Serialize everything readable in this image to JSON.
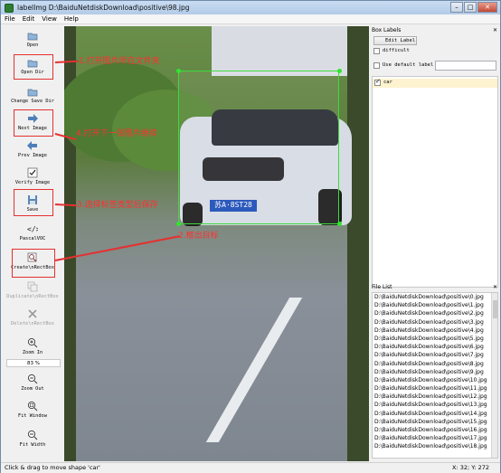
{
  "window": {
    "title": "labelImg D:\\BaiduNetdiskDownload\\positive\\98.jpg"
  },
  "menu": [
    "File",
    "Edit",
    "View",
    "Help"
  ],
  "toolbar": {
    "open": "Open",
    "open_dir": "Open Dir",
    "change_save_dir": "Change Save Dir",
    "next_image": "Next Image",
    "prev_image": "Prev Image",
    "verify_image": "Verify Image",
    "save": "Save",
    "format": "PascalVOC",
    "create_rect_box": "Create\\nRectBox",
    "duplicate_rect_box": "Duplicate\\nRectBox",
    "delete_rect_box": "Delete\\nRectBox",
    "zoom_in": "Zoom In",
    "zoom_value": "83 %",
    "zoom_out": "Zoom Out",
    "fit_window": "Fit Window",
    "fit_width": "Fit Width"
  },
  "annotations": {
    "step1": "1.打开图片所在文件夹",
    "step2": "2.框出目标",
    "step3": "3.选择标签类型后保存",
    "step4": "4.打开下一张图片继续"
  },
  "image": {
    "plate_text": "苏A·8ST28"
  },
  "box_labels": {
    "title": "Box Labels",
    "edit_label": "Edit Label",
    "difficult": "difficult",
    "use_default_label": "Use default label",
    "default_label_value": "",
    "labels": [
      {
        "name": "car",
        "checked": true
      }
    ]
  },
  "file_list": {
    "title": "File List",
    "items": [
      "D:\\BaiduNetdiskDownload\\positive\\0.jpg",
      "D:\\BaiduNetdiskDownload\\positive\\1.jpg",
      "D:\\BaiduNetdiskDownload\\positive\\2.jpg",
      "D:\\BaiduNetdiskDownload\\positive\\3.jpg",
      "D:\\BaiduNetdiskDownload\\positive\\4.jpg",
      "D:\\BaiduNetdiskDownload\\positive\\5.jpg",
      "D:\\BaiduNetdiskDownload\\positive\\6.jpg",
      "D:\\BaiduNetdiskDownload\\positive\\7.jpg",
      "D:\\BaiduNetdiskDownload\\positive\\8.jpg",
      "D:\\BaiduNetdiskDownload\\positive\\9.jpg",
      "D:\\BaiduNetdiskDownload\\positive\\10.jpg",
      "D:\\BaiduNetdiskDownload\\positive\\11.jpg",
      "D:\\BaiduNetdiskDownload\\positive\\12.jpg",
      "D:\\BaiduNetdiskDownload\\positive\\13.jpg",
      "D:\\BaiduNetdiskDownload\\positive\\14.jpg",
      "D:\\BaiduNetdiskDownload\\positive\\15.jpg",
      "D:\\BaiduNetdiskDownload\\positive\\16.jpg",
      "D:\\BaiduNetdiskDownload\\positive\\17.jpg",
      "D:\\BaiduNetdiskDownload\\positive\\18.jpg"
    ]
  },
  "status": {
    "message": "Click & drag to move shape 'car'",
    "coords": "X: 32; Y: 272"
  },
  "colors": {
    "annotation_red": "#e53030",
    "bbox_green": "#3ddc3d",
    "selected_row": "#fdf3d0"
  }
}
